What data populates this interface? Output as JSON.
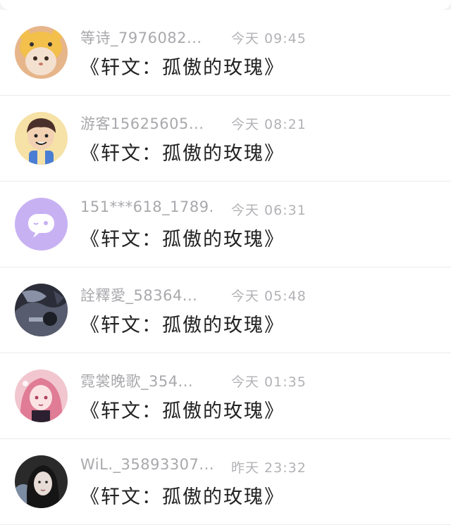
{
  "messages": [
    {
      "name": "等诗_7976082...",
      "time": "今天 09:45",
      "title": "《轩文：孤傲的玫瑰》",
      "avatar_icon": "cat-costume-avatar",
      "avatar_color": "#e8b07a"
    },
    {
      "name": "游客15625605...",
      "time": "今天 08:21",
      "title": "《轩文：孤傲的玫瑰》",
      "avatar_icon": "cartoon-boy-avatar",
      "avatar_color": "#f7e4a8"
    },
    {
      "name": "151***618_1789...",
      "time": "今天 06:31",
      "title": "《轩文：孤傲的玫瑰》",
      "avatar_icon": "chat-bubble-avatar",
      "avatar_color": "#c7b1f2"
    },
    {
      "name": "詮釋愛_58364...",
      "time": "今天 05:48",
      "title": "《轩文：孤傲的玫瑰》",
      "avatar_icon": "dark-photo-avatar",
      "avatar_color": "#2c2f3a"
    },
    {
      "name": "霓裳晚歌_354...",
      "time": "今天 01:35",
      "title": "《轩文：孤傲的玫瑰》",
      "avatar_icon": "anime-girl-avatar",
      "avatar_color": "#e9b7c3"
    },
    {
      "name": "WiL._35893307...",
      "time": "昨天 23:32",
      "title": "《轩文：孤傲的玫瑰》",
      "avatar_icon": "portrait-photo-avatar",
      "avatar_color": "#3a3a3a"
    }
  ]
}
